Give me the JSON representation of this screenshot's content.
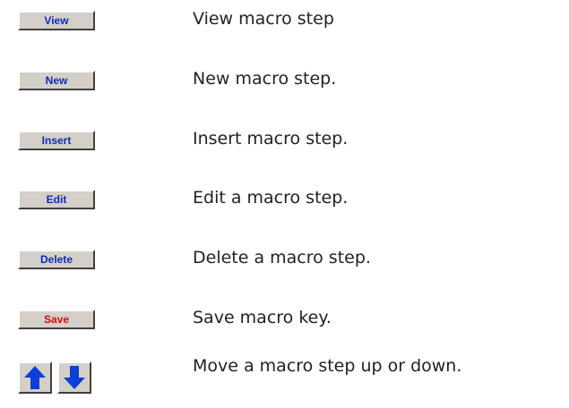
{
  "rows": [
    {
      "button_label": "View",
      "description": "View macro step"
    },
    {
      "button_label": "New",
      "description": "New macro step."
    },
    {
      "button_label": "Insert",
      "description": "Insert macro step."
    },
    {
      "button_label": "Edit",
      "description": "Edit a macro step."
    },
    {
      "button_label": "Delete",
      "description": "Delete a macro step."
    },
    {
      "button_label": "Save",
      "description": "Save macro key."
    }
  ],
  "move": {
    "description": "Move a macro step up or down.",
    "up_icon": "arrow-up-icon",
    "down_icon": "arrow-down-icon"
  },
  "colors": {
    "button_text": "#0b2cb8",
    "save_text": "#d01010",
    "arrow_fill": "#0a3fd8",
    "button_face": "#d4d0c8"
  }
}
